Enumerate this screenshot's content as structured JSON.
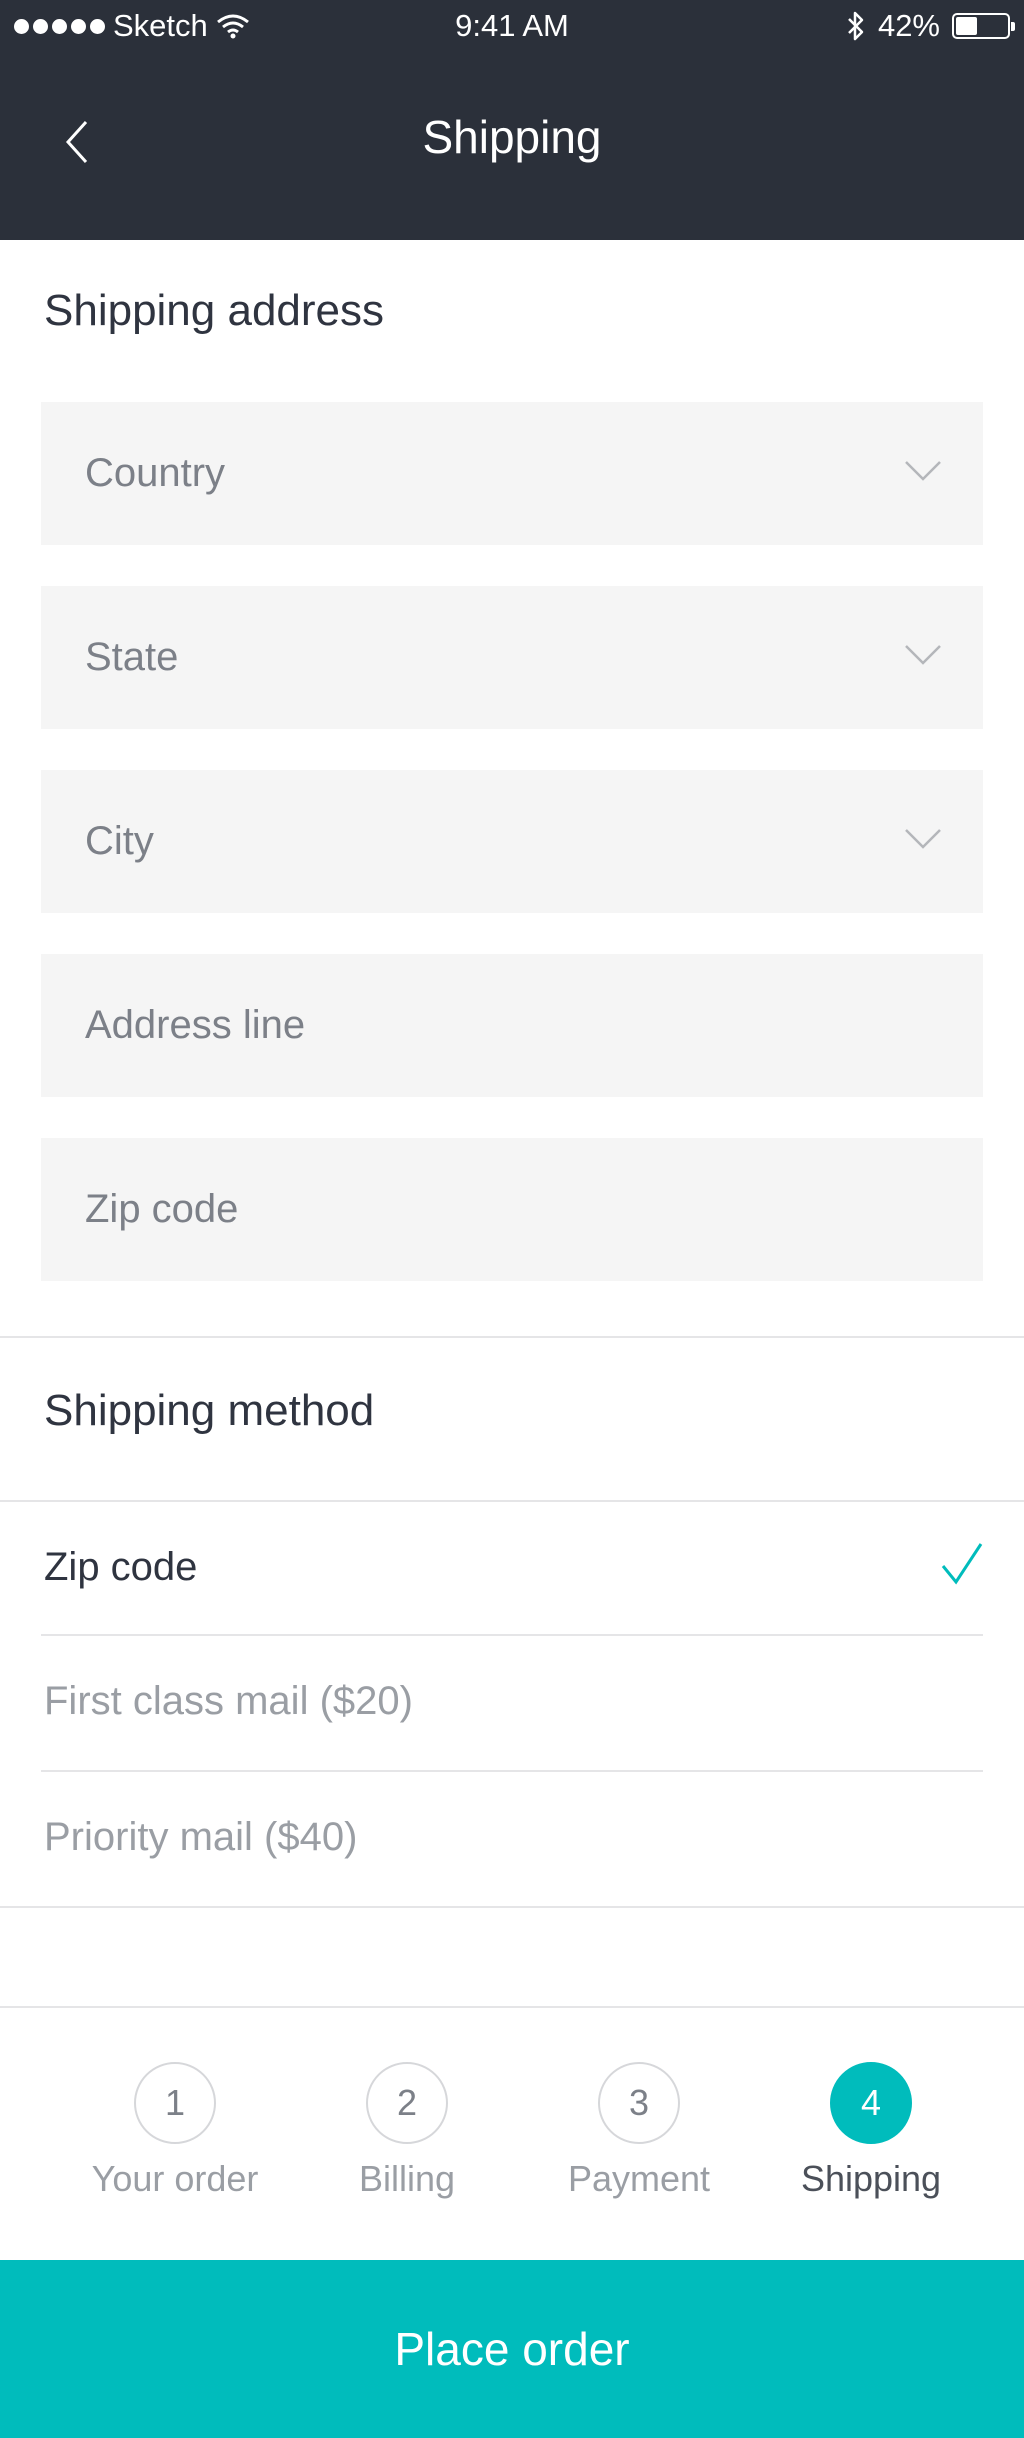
{
  "status_bar": {
    "carrier": "Sketch",
    "time": "9:41 AM",
    "battery": "42%",
    "battery_level": 0.42
  },
  "nav": {
    "title": "Shipping"
  },
  "shipping_address": {
    "title": "Shipping address",
    "fields": [
      {
        "placeholder": "Country",
        "type": "dropdown"
      },
      {
        "placeholder": "State",
        "type": "dropdown"
      },
      {
        "placeholder": "City",
        "type": "dropdown"
      },
      {
        "placeholder": "Address line",
        "type": "text"
      },
      {
        "placeholder": "Zip code",
        "type": "text"
      }
    ]
  },
  "shipping_method": {
    "title": "Shipping method",
    "options": [
      {
        "label": "Zip code",
        "selected": true
      },
      {
        "label": "First class mail ($20)",
        "selected": false
      },
      {
        "label": "Priority mail ($40)",
        "selected": false
      }
    ]
  },
  "steps": [
    {
      "number": "1",
      "label": "Your order"
    },
    {
      "number": "2",
      "label": "Billing"
    },
    {
      "number": "3",
      "label": "Payment"
    },
    {
      "number": "4",
      "label": "Shipping",
      "active": true
    }
  ],
  "cta": {
    "label": "Place order"
  },
  "colors": {
    "header_bg": "#2b303a",
    "accent": "#00bcbc",
    "field_bg": "#f5f5f5"
  },
  "icons": {
    "back": "chevron-left-icon",
    "dropdown": "chevron-down-icon",
    "selected": "checkmark-icon"
  }
}
